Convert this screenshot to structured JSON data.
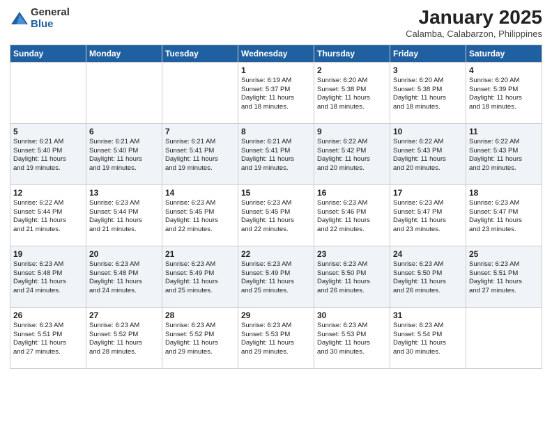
{
  "logo": {
    "general": "General",
    "blue": "Blue"
  },
  "header": {
    "title": "January 2025",
    "subtitle": "Calamba, Calabarzon, Philippines"
  },
  "weekdays": [
    "Sunday",
    "Monday",
    "Tuesday",
    "Wednesday",
    "Thursday",
    "Friday",
    "Saturday"
  ],
  "weeks": [
    [
      {
        "day": "",
        "info": ""
      },
      {
        "day": "",
        "info": ""
      },
      {
        "day": "",
        "info": ""
      },
      {
        "day": "1",
        "info": "Sunrise: 6:19 AM\nSunset: 5:37 PM\nDaylight: 11 hours\nand 18 minutes."
      },
      {
        "day": "2",
        "info": "Sunrise: 6:20 AM\nSunset: 5:38 PM\nDaylight: 11 hours\nand 18 minutes."
      },
      {
        "day": "3",
        "info": "Sunrise: 6:20 AM\nSunset: 5:38 PM\nDaylight: 11 hours\nand 18 minutes."
      },
      {
        "day": "4",
        "info": "Sunrise: 6:20 AM\nSunset: 5:39 PM\nDaylight: 11 hours\nand 18 minutes."
      }
    ],
    [
      {
        "day": "5",
        "info": "Sunrise: 6:21 AM\nSunset: 5:40 PM\nDaylight: 11 hours\nand 19 minutes."
      },
      {
        "day": "6",
        "info": "Sunrise: 6:21 AM\nSunset: 5:40 PM\nDaylight: 11 hours\nand 19 minutes."
      },
      {
        "day": "7",
        "info": "Sunrise: 6:21 AM\nSunset: 5:41 PM\nDaylight: 11 hours\nand 19 minutes."
      },
      {
        "day": "8",
        "info": "Sunrise: 6:21 AM\nSunset: 5:41 PM\nDaylight: 11 hours\nand 19 minutes."
      },
      {
        "day": "9",
        "info": "Sunrise: 6:22 AM\nSunset: 5:42 PM\nDaylight: 11 hours\nand 20 minutes."
      },
      {
        "day": "10",
        "info": "Sunrise: 6:22 AM\nSunset: 5:43 PM\nDaylight: 11 hours\nand 20 minutes."
      },
      {
        "day": "11",
        "info": "Sunrise: 6:22 AM\nSunset: 5:43 PM\nDaylight: 11 hours\nand 20 minutes."
      }
    ],
    [
      {
        "day": "12",
        "info": "Sunrise: 6:22 AM\nSunset: 5:44 PM\nDaylight: 11 hours\nand 21 minutes."
      },
      {
        "day": "13",
        "info": "Sunrise: 6:23 AM\nSunset: 5:44 PM\nDaylight: 11 hours\nand 21 minutes."
      },
      {
        "day": "14",
        "info": "Sunrise: 6:23 AM\nSunset: 5:45 PM\nDaylight: 11 hours\nand 22 minutes."
      },
      {
        "day": "15",
        "info": "Sunrise: 6:23 AM\nSunset: 5:45 PM\nDaylight: 11 hours\nand 22 minutes."
      },
      {
        "day": "16",
        "info": "Sunrise: 6:23 AM\nSunset: 5:46 PM\nDaylight: 11 hours\nand 22 minutes."
      },
      {
        "day": "17",
        "info": "Sunrise: 6:23 AM\nSunset: 5:47 PM\nDaylight: 11 hours\nand 23 minutes."
      },
      {
        "day": "18",
        "info": "Sunrise: 6:23 AM\nSunset: 5:47 PM\nDaylight: 11 hours\nand 23 minutes."
      }
    ],
    [
      {
        "day": "19",
        "info": "Sunrise: 6:23 AM\nSunset: 5:48 PM\nDaylight: 11 hours\nand 24 minutes."
      },
      {
        "day": "20",
        "info": "Sunrise: 6:23 AM\nSunset: 5:48 PM\nDaylight: 11 hours\nand 24 minutes."
      },
      {
        "day": "21",
        "info": "Sunrise: 6:23 AM\nSunset: 5:49 PM\nDaylight: 11 hours\nand 25 minutes."
      },
      {
        "day": "22",
        "info": "Sunrise: 6:23 AM\nSunset: 5:49 PM\nDaylight: 11 hours\nand 25 minutes."
      },
      {
        "day": "23",
        "info": "Sunrise: 6:23 AM\nSunset: 5:50 PM\nDaylight: 11 hours\nand 26 minutes."
      },
      {
        "day": "24",
        "info": "Sunrise: 6:23 AM\nSunset: 5:50 PM\nDaylight: 11 hours\nand 26 minutes."
      },
      {
        "day": "25",
        "info": "Sunrise: 6:23 AM\nSunset: 5:51 PM\nDaylight: 11 hours\nand 27 minutes."
      }
    ],
    [
      {
        "day": "26",
        "info": "Sunrise: 6:23 AM\nSunset: 5:51 PM\nDaylight: 11 hours\nand 27 minutes."
      },
      {
        "day": "27",
        "info": "Sunrise: 6:23 AM\nSunset: 5:52 PM\nDaylight: 11 hours\nand 28 minutes."
      },
      {
        "day": "28",
        "info": "Sunrise: 6:23 AM\nSunset: 5:52 PM\nDaylight: 11 hours\nand 29 minutes."
      },
      {
        "day": "29",
        "info": "Sunrise: 6:23 AM\nSunset: 5:53 PM\nDaylight: 11 hours\nand 29 minutes."
      },
      {
        "day": "30",
        "info": "Sunrise: 6:23 AM\nSunset: 5:53 PM\nDaylight: 11 hours\nand 30 minutes."
      },
      {
        "day": "31",
        "info": "Sunrise: 6:23 AM\nSunset: 5:54 PM\nDaylight: 11 hours\nand 30 minutes."
      },
      {
        "day": "",
        "info": ""
      }
    ]
  ]
}
